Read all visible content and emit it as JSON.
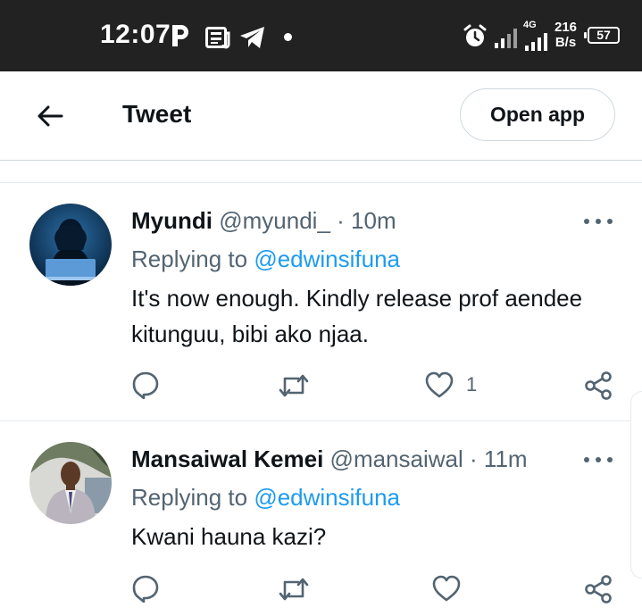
{
  "status_bar": {
    "time": "12:07",
    "net_type": "4G",
    "net_speed_value": "216",
    "net_speed_unit": "B/s",
    "battery": "57",
    "icons": [
      "parking-icon",
      "news-icon",
      "telegram-icon",
      "alarm-icon",
      "signal-icon",
      "signal-4g-icon"
    ]
  },
  "header": {
    "title": "Tweet",
    "open_app_label": "Open app",
    "back_icon": "arrow-left-icon"
  },
  "tweets": [
    {
      "name": "Myundi",
      "handle": "@myundi_",
      "separator": "·",
      "time": "10m",
      "replying_prefix": "Replying to",
      "replying_to": "@edwinsifuna",
      "text": "It's now enough. Kindly release prof aendee kitunguu, bibi ako njaa.",
      "like_count": "1"
    },
    {
      "name": "Mansaiwal Kemei",
      "handle": "@mansaiwal",
      "separator": "·",
      "time": "11m",
      "replying_prefix": "Replying to",
      "replying_to": "@edwinsifuna",
      "text": "Kwani hauna kazi?",
      "like_count": ""
    }
  ],
  "colors": {
    "status_bar_bg": "#222222",
    "link": "#1d9bf0",
    "muted_text": "#536471",
    "primary_text": "#0f1419",
    "divider": "#e6ecf0"
  }
}
